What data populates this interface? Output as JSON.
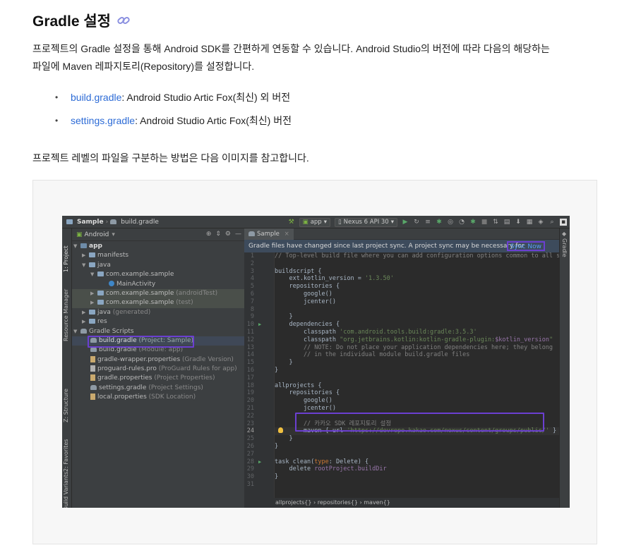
{
  "doc": {
    "title": "Gradle 설정",
    "intro_line1": "프로젝트의 Gradle 설정을 통해 Android SDK를 간편하게 연동할 수 있습니다. Android Studio의 버전에 따라 다음의 해당하는",
    "intro_line2": "파일에 Maven 레파지토리(Repository)를 설정합니다.",
    "bullets": [
      {
        "link": "build.gradle",
        "text": ": Android Studio Artic Fox(최신) 외 버전"
      },
      {
        "link": "settings.gradle",
        "text": ": Android Studio Artic Fox(최신) 버전"
      }
    ],
    "guide": "프로젝트 레벨의 파일을 구분하는 방법은 다음 이미지를 참고합니다.",
    "link_color": "#2c6bd6",
    "highlight_color": "#6b3fd1"
  },
  "ide": {
    "breadcrumb": {
      "project": "Sample",
      "file": "build.gradle"
    },
    "toolbar": {
      "module": "app",
      "device": "Nexus 6 API 30"
    },
    "left_tabs": [
      "1: Project",
      "Resource Manager",
      "Z: Structure",
      "2: Favorites",
      "Build Variants"
    ],
    "right_tab": "Gradle",
    "project_view": "Android",
    "tree": {
      "app": "app",
      "manifests": "manifests",
      "java": "java",
      "pkg1": "com.example.sample",
      "main_activity": "MainActivity",
      "pkg2": "com.example.sample",
      "pkg2_tag": "(androidTest)",
      "pkg3": "com.example.sample",
      "pkg3_tag": "(test)",
      "java_gen": "java",
      "java_gen_tag": "(generated)",
      "res": "res",
      "gradle_scripts": "Gradle Scripts",
      "bg_project": "build.gradle",
      "bg_project_tag": "(Project: Sample)",
      "bg_module": "build.gradle",
      "bg_module_tag": "(Module: app)",
      "wrapper": "gradle-wrapper.properties",
      "wrapper_tag": "(Gradle Version)",
      "proguard": "proguard-rules.pro",
      "proguard_tag": "(ProGuard Rules for app)",
      "gprops": "gradle.properties",
      "gprops_tag": "(Project Properties)",
      "settings": "settings.gradle",
      "settings_tag": "(Project Settings)",
      "local": "local.properties",
      "local_tag": "(SDK Location)"
    },
    "editor_tab": "Sample",
    "notice": "Gradle files have changed since last project sync. A project sync may be necessary for",
    "sync_now": "Sync Now",
    "line_numbers": [
      "1",
      "2",
      "3",
      "4",
      "5",
      "6",
      "7",
      "8",
      "9",
      "10",
      "11",
      "12",
      "13",
      "14",
      "15",
      "16",
      "17",
      "18",
      "19",
      "20",
      "21",
      "22",
      "23",
      "24",
      "25",
      "26",
      "27",
      "28",
      "29",
      "30",
      "31"
    ],
    "code": {
      "l1": "// Top-level build file where you can add configuration options common to all sub-p",
      "l3": "buildscript {",
      "l4a": "    ext.kotlin_version = ",
      "l4b": "'1.3.50'",
      "l5": "    repositories {",
      "l6": "        google()",
      "l7": "        jcenter()",
      "l9": "    }",
      "l10": "    dependencies {",
      "l11a": "        classpath ",
      "l11b": "'com.android.tools.build:gradle:3.5.3'",
      "l12a": "        classpath ",
      "l12b": "\"org.jetbrains.kotlin:kotlin-gradle-plugin:",
      "l12c": "$kotlin_version",
      "l12d": "\"",
      "l13": "        // NOTE: Do not place your application dependencies here; they belong",
      "l14": "        // in the individual module build.gradle files",
      "l15": "    }",
      "l16": "}",
      "l18": "allprojects {",
      "l19": "    repositories {",
      "l20": "        google()",
      "l21": "        jcenter()",
      "l23": "        // 카카오 SDK 레포지토리 설정",
      "l24a": "        maven { url ",
      "l24b": "'https://devrepo.kakao.com/nexus/content/groups/public/'",
      "l24c": " }",
      "l25": "    }",
      "l26": "}",
      "l28a": "task clean(",
      "l28b": "type",
      "l28c": ": Delete) {",
      "l29a": "    delete ",
      "l29b": "rootProject.buildDir",
      "l30": "}"
    },
    "bottom_breadcrumb": "allprojects{}  ›  repositories{}  ›  maven{}"
  }
}
